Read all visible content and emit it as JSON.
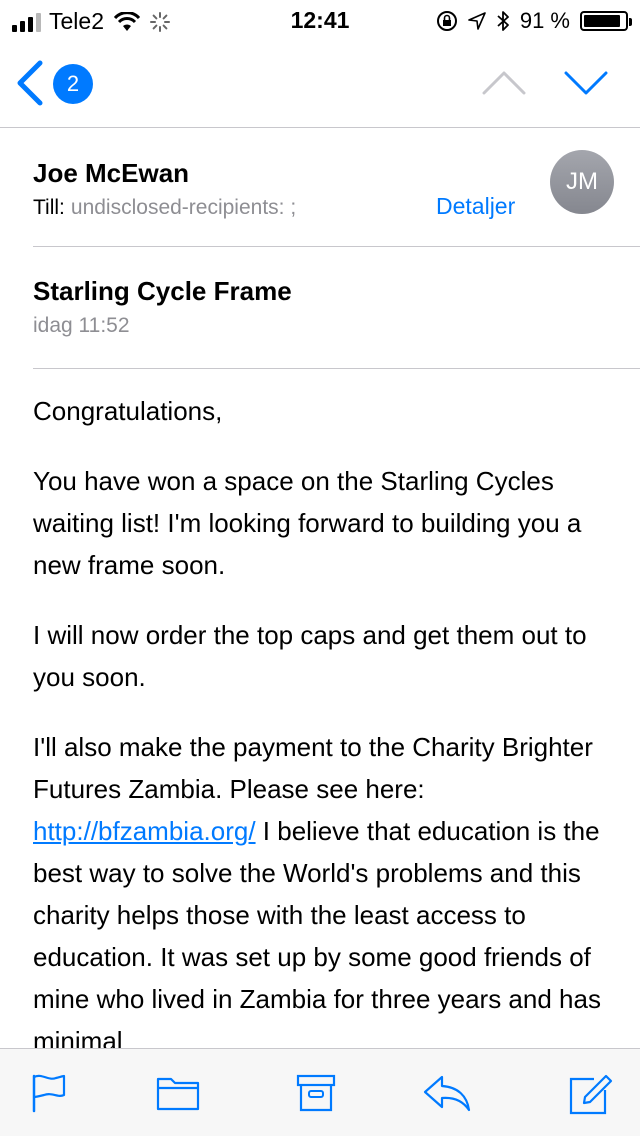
{
  "status_bar": {
    "carrier": "Tele2",
    "time": "12:41",
    "battery_text": "91 %",
    "battery_level": 0.91,
    "icons": [
      "signal-icon",
      "wifi-icon",
      "activity-spinner-icon",
      "rotation-lock-icon",
      "location-icon",
      "bluetooth-icon",
      "battery-icon"
    ]
  },
  "nav": {
    "back_badge": "2",
    "icons": [
      "back-chevron-icon",
      "previous-message-icon",
      "next-message-icon"
    ]
  },
  "email": {
    "sender": "Joe McEwan",
    "to_label": "Till:",
    "recipients": "undisclosed-recipients: ;",
    "details_label": "Detaljer",
    "avatar_initials": "JM",
    "subject": "Starling Cycle Frame",
    "date": "idag 11:52",
    "body": {
      "p1": "Congratulations,",
      "p2": "You have won a space on the Starling Cycles waiting list!  I'm looking forward to building you a new frame soon.",
      "p3": "I will now order the top caps and get them out to you soon.",
      "p4_before": "I'll also make the payment to the Charity Brighter Futures Zambia.  Please see here: ",
      "p4_link": "http://bfzambia.org/",
      "p4_after": "  I believe that education is the best way to solve the World's problems and this charity helps those with the least access to education.  It was set up by some good friends of mine who lived in Zambia for three years and has minimal"
    }
  },
  "toolbar": {
    "icons": [
      "flag-icon",
      "folder-icon",
      "archive-icon",
      "reply-icon",
      "compose-icon"
    ],
    "accent": "#007aff"
  }
}
